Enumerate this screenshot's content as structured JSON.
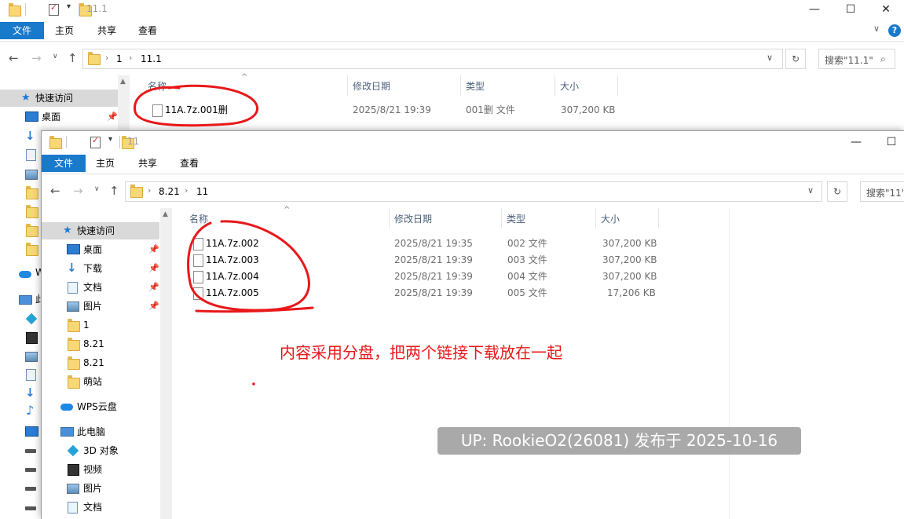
{
  "back_window": {
    "title": "11.1",
    "ribbon_tabs": [
      "文件",
      "主页",
      "共享",
      "查看"
    ],
    "address": [
      "1",
      "11.1"
    ],
    "search_placeholder": "搜索\"11.1\"",
    "columns": [
      "名称",
      "修改日期",
      "类型",
      "大小"
    ],
    "files": [
      {
        "name": "11A.7z.001删",
        "date": "2025/8/21 19:39",
        "type": "001删 文件",
        "size": "307,200 KB"
      }
    ],
    "nav": {
      "quick_access": "快速访问",
      "desktop": "桌面",
      "w_partial": "W",
      "pc_partial": "此"
    }
  },
  "front_window": {
    "title": "11",
    "ribbon_tabs": [
      "文件",
      "主页",
      "共享",
      "查看"
    ],
    "address": [
      "8.21",
      "11"
    ],
    "search_placeholder": "搜索\"11\"",
    "columns": [
      "名称",
      "修改日期",
      "类型",
      "大小"
    ],
    "files": [
      {
        "name": "11A.7z.002",
        "date": "2025/8/21 19:35",
        "type": "002 文件",
        "size": "307,200 KB"
      },
      {
        "name": "11A.7z.003",
        "date": "2025/8/21 19:39",
        "type": "003 文件",
        "size": "307,200 KB"
      },
      {
        "name": "11A.7z.004",
        "date": "2025/8/21 19:39",
        "type": "004 文件",
        "size": "307,200 KB"
      },
      {
        "name": "11A.7z.005",
        "date": "2025/8/21 19:39",
        "type": "005 文件",
        "size": "17,206 KB"
      }
    ],
    "nav": {
      "quick_access": "快速访问",
      "desktop": "桌面",
      "downloads": "下载",
      "documents": "文档",
      "pictures": "图片",
      "folder_1": "1",
      "folder_821a": "8.21",
      "folder_821b": "8.21",
      "folder_mengzhan": "萌站",
      "wps_cloud": "WPS云盘",
      "this_pc": "此电脑",
      "objects_3d": "3D 对象",
      "videos": "视频",
      "pc_pictures": "图片",
      "pc_documents": "文档"
    }
  },
  "annotation_text": "内容采用分盘，把两个链接下载放在一起",
  "watermark": "UP: RookieO2(26081) 发布于 2025-10-16",
  "colors": {
    "accent": "#1979ca",
    "annotation": "#e8181a"
  }
}
